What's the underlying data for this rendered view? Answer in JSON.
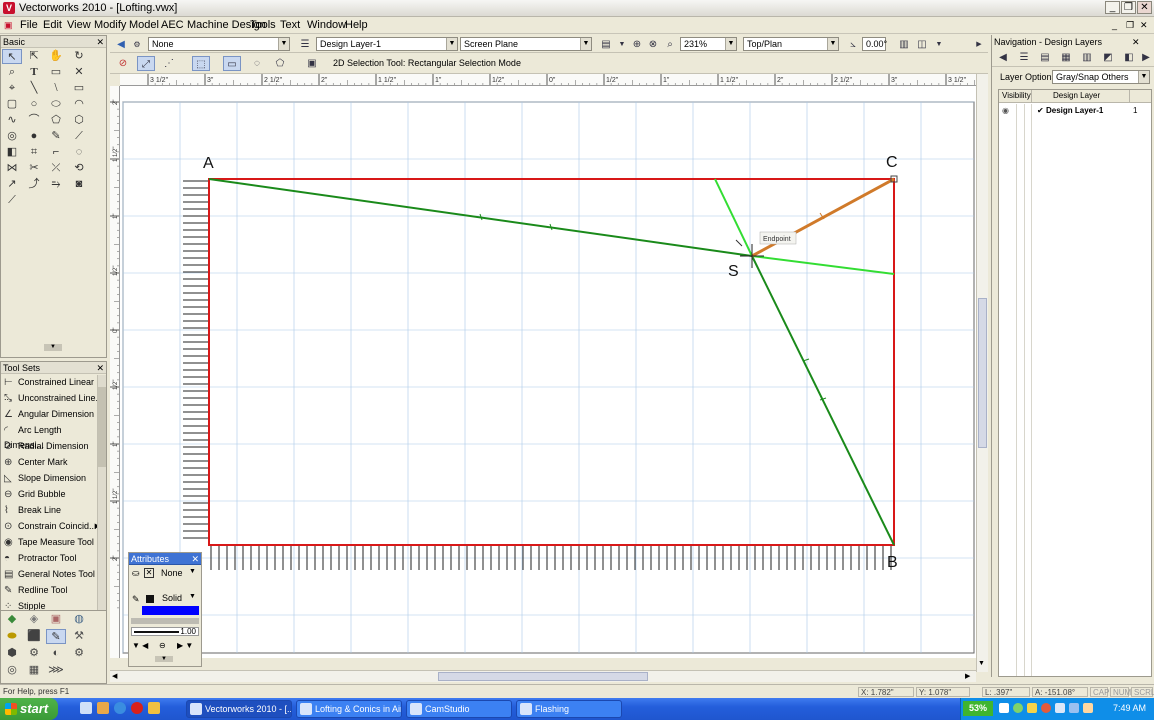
{
  "window": {
    "title": "Vectorworks 2010 - [Lofting.vwx]"
  },
  "menubar": {
    "items": [
      "File",
      "Edit",
      "View",
      "Modify",
      "Model",
      "AEC",
      "Machine Design",
      "Tools",
      "Text",
      "Window",
      "Help"
    ]
  },
  "basic_palette": {
    "title": "Basic"
  },
  "tool_sets": {
    "title": "Tool Sets",
    "items": [
      "Constrained Linear ...",
      "Unconstrained Line...",
      "Angular Dimension",
      "Arc Length Dimensi...",
      "Radial Dimension",
      "Center Mark",
      "Slope Dimension",
      "Grid Bubble",
      "Break Line",
      "Constrain Coincid...",
      "Tape Measure Tool",
      "Protractor Tool",
      "General Notes Tool",
      "Redline Tool",
      "Stipple"
    ]
  },
  "view_bar": {
    "class": "None",
    "layer": "Design Layer-1",
    "plane": "Screen Plane",
    "zoom": "231%",
    "view": "Top/Plan",
    "angle": "0.00°"
  },
  "mode_bar": {
    "message": "2D Selection Tool: Rectangular Selection Mode"
  },
  "ruler": {
    "top_labels": [
      "3 1/2\"",
      "3\"",
      "2 1/2\"",
      "2\"",
      "1 1/2\"",
      "1\"",
      "1/2\"",
      "0\"",
      "1/2\"",
      "1\"",
      "1 1/2\"",
      "2\"",
      "2 1/2\"",
      "3\"",
      "3 1/2\""
    ],
    "left_labels": [
      "2\"",
      "1 1/2\"",
      "1\"",
      "1/2\"",
      "0\"",
      "1/2\"",
      "1\"",
      "1 1/2\"",
      "2\""
    ]
  },
  "drawing": {
    "points": {
      "a": "A",
      "b": "B",
      "c": "C",
      "s": "S"
    },
    "snap_hint": "Endpoint"
  },
  "attributes": {
    "title": "Attributes",
    "fill": "None",
    "pen": "Solid",
    "line_weight": "1.00",
    "pen_color": "#0000ff"
  },
  "navigation": {
    "title": "Navigation - Design Layers",
    "layer_options_label": "Layer Options:",
    "layer_options_value": "Gray/Snap Others",
    "columns": [
      "Visibility",
      "Design Layer"
    ],
    "layers": [
      {
        "name": "Design Layer-1",
        "number": "1",
        "active_mark": "✔"
      }
    ]
  },
  "status": {
    "help": "For Help, press F1",
    "x": "X: 1.782\"",
    "y": "Y: 1.078\"",
    "l": "L: .397\"",
    "a": "A: -151.08°",
    "caps": "CAP",
    "num": "NUM",
    "scrl": "SCRL"
  },
  "taskbar": {
    "start": "start",
    "tasks": [
      "Vectorworks 2010 - [...",
      "Lofting & Conics in Air...",
      "CamStudio",
      "Flashing"
    ],
    "battery": "53%",
    "clock": "7:49 AM"
  },
  "colors": {
    "rect": "#d81818",
    "green": "#1a8a1a",
    "light_green": "#33dd33",
    "orange": "#d07a2a",
    "grid": "#a8c8e8"
  }
}
